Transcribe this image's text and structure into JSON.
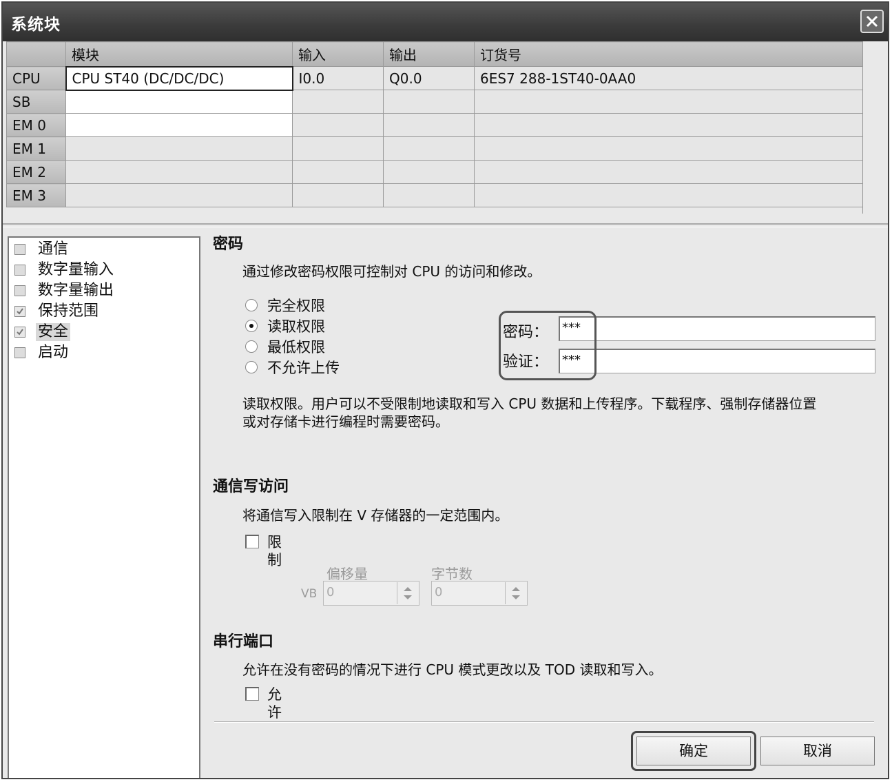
{
  "window": {
    "title": "系统块"
  },
  "grid": {
    "headers": [
      "",
      "模块",
      "输入",
      "输出",
      "订货号"
    ],
    "rows": [
      {
        "slot": "CPU",
        "module": "CPU ST40 (DC/DC/DC)",
        "input": "I0.0",
        "output": "Q0.0",
        "order": "6ES7 288-1ST40-0AA0"
      },
      {
        "slot": "SB",
        "module": "",
        "input": "",
        "output": "",
        "order": ""
      },
      {
        "slot": "EM 0",
        "module": "",
        "input": "",
        "output": "",
        "order": ""
      },
      {
        "slot": "EM 1",
        "module": "",
        "input": "",
        "output": "",
        "order": ""
      },
      {
        "slot": "EM 2",
        "module": "",
        "input": "",
        "output": "",
        "order": ""
      },
      {
        "slot": "EM 3",
        "module": "",
        "input": "",
        "output": "",
        "order": ""
      }
    ]
  },
  "tree": {
    "items": [
      {
        "label": "通信",
        "checked": false
      },
      {
        "label": "数字量输入",
        "checked": false
      },
      {
        "label": "数字量输出",
        "checked": false
      },
      {
        "label": "保持范围",
        "checked": true
      },
      {
        "label": "安全",
        "checked": true,
        "selected": true
      },
      {
        "label": "启动",
        "checked": false
      }
    ]
  },
  "password": {
    "title": "密码",
    "description": "通过修改密码权限可控制对 CPU 的访问和修改。",
    "options": [
      "完全权限",
      "读取权限",
      "最低权限",
      "不允许上传"
    ],
    "selected": "读取权限",
    "password_label": "密码：",
    "password_value": "***",
    "verify_label": "验证：",
    "verify_value": "***",
    "note_line1": "读取权限。用户可以不受限制地读取和写入 CPU 数据和上传程序。下载程序、强制存储器位置",
    "note_line2": "或对存储卡进行编程时需要密码。"
  },
  "comm_write": {
    "title": "通信写访问",
    "description": "将通信写入限制在 V 存储器的一定范围内。",
    "restrict_label": "限制",
    "restrict_checked": false,
    "offset_label": "偏移量",
    "bytes_label": "字节数",
    "vb_prefix": "VB",
    "offset_value": "0",
    "bytes_value": "0"
  },
  "serial_port": {
    "title": "串行端口",
    "description": "允许在没有密码的情况下进行 CPU 模式更改以及 TOD 读取和写入。",
    "allow_label": "允许",
    "allow_checked": false
  },
  "buttons": {
    "ok": "确定",
    "cancel": "取消"
  },
  "icons": {
    "close": "close-icon",
    "checkbox_checked": "check-icon"
  }
}
